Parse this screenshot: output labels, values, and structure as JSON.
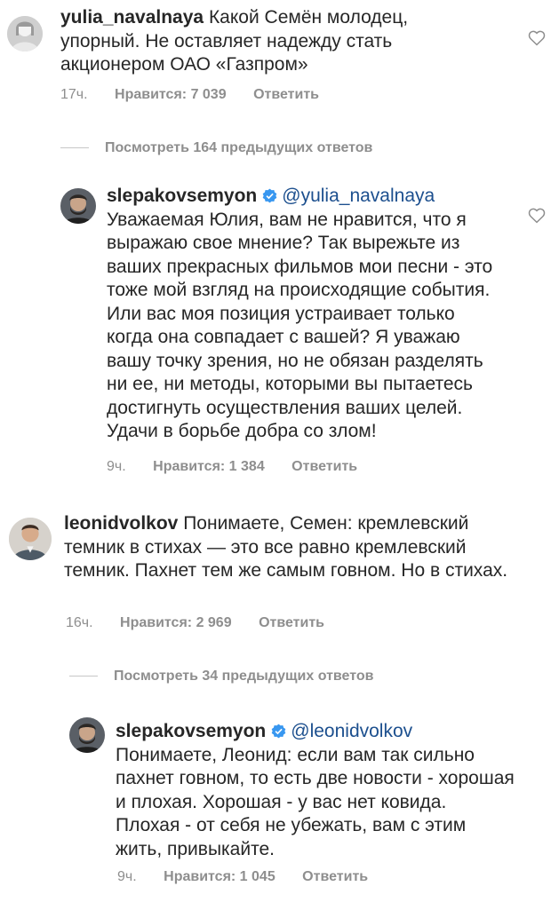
{
  "comments": [
    {
      "username": "yulia_navalnaya",
      "text": "Какой Семён молодец, упорный. Не оставляет надежду стать акционером  ОАО «Газпром»",
      "time": "17ч.",
      "likes": "Нравится: 7 039",
      "reply": "Ответить"
    },
    {
      "username": "slepakovsemyon",
      "mention": "@yulia_navalnaya",
      "text": "Уважаемая Юлия, вам не нравится, что я выражаю свое мнение? Так вырежьте из ваших прекрасных фильмов мои песни - это тоже мой взгляд на происходящие события. Или вас моя позиция устраивает только когда она совпадает с вашей? Я уважаю вашу точку зрения, но не обязан разделять ни ее, ни методы, которыми вы пытаетесь достигнуть осуществления ваших целей. Удачи в борьбе добра со злом!",
      "time": "9ч.",
      "likes": "Нравится: 1 384",
      "reply": "Ответить"
    },
    {
      "username": "leonidvolkov",
      "text": "Понимаете, Семен: кремлевский темник в стихах — это все равно кремлевский темник. Пахнет тем же самым говном. Но в стихах.",
      "time": "16ч.",
      "likes": "Нравится: 2 969",
      "reply": "Ответить"
    },
    {
      "username": "slepakovsemyon",
      "mention": "@leonidvolkov",
      "text": "Понимаете, Леонид: если вам так сильно пахнет говном, то есть две новости - хорошая и плохая. Хорошая - у вас нет ковида. Плохая - от себя не убежать, вам с этим жить, привыкайте.",
      "time": "9ч.",
      "likes": "Нравится: 1 045",
      "reply": "Ответить"
    }
  ],
  "view_replies": [
    "Посмотреть 164 предыдущих ответов",
    "Посмотреть 34 предыдущих ответов"
  ],
  "icons": {
    "like": "heart-icon",
    "verified": "verified-badge-icon"
  },
  "colors": {
    "text": "#262626",
    "secondary": "#8e8e8e",
    "mention": "#1c4f8e",
    "verified": "#3897f0"
  }
}
